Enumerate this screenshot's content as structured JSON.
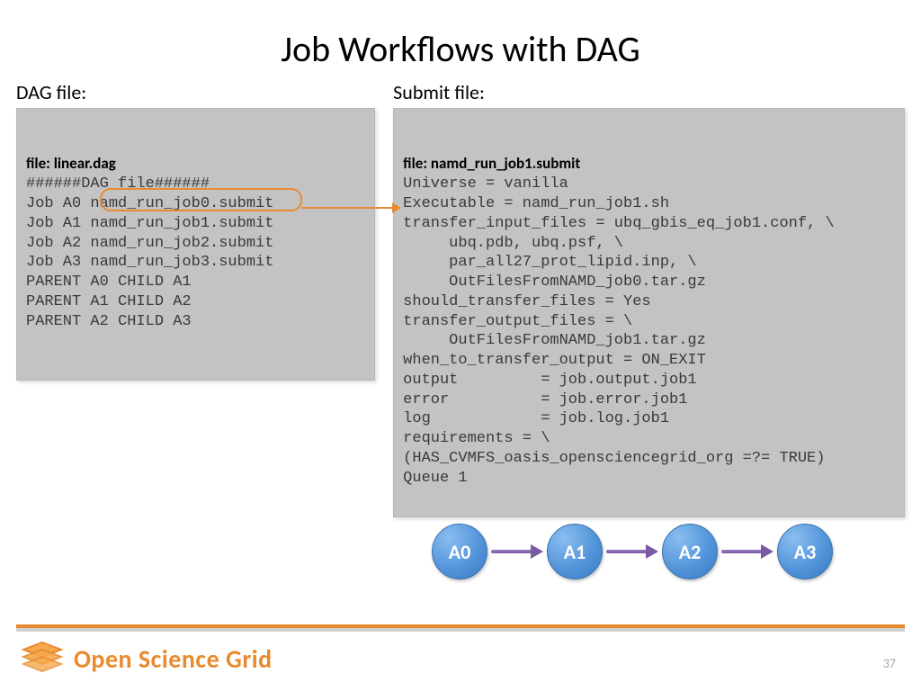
{
  "title": "Job Workflows with DAG",
  "left": {
    "label": "DAG file:",
    "file_header": "file: linear.dag",
    "code": "######DAG file######\nJob A0 namd_run_job0.submit\nJob A1 namd_run_job1.submit\nJob A2 namd_run_job2.submit\nJob A3 namd_run_job3.submit\nPARENT A0 CHILD A1\nPARENT A1 CHILD A2\nPARENT A2 CHILD A3"
  },
  "right": {
    "label": "Submit file:",
    "file_header": "file: namd_run_job1.submit",
    "code": "Universe = vanilla\nExecutable = namd_run_job1.sh\ntransfer_input_files = ubq_gbis_eq_job1.conf, \\\n     ubq.pdb, ubq.psf, \\\n     par_all27_prot_lipid.inp, \\\n     OutFilesFromNAMD_job0.tar.gz\nshould_transfer_files = Yes\ntransfer_output_files = \\\n     OutFilesFromNAMD_job1.tar.gz\nwhen_to_transfer_output = ON_EXIT\noutput         = job.output.job1\nerror          = job.error.job1\nlog            = job.log.job1\nrequirements = \\\n(HAS_CVMFS_oasis_opensciencegrid_org =?= TRUE)\nQueue 1"
  },
  "nodes": [
    "A0",
    "A1",
    "A2",
    "A3"
  ],
  "footer": "Open Science Grid",
  "page": "37"
}
